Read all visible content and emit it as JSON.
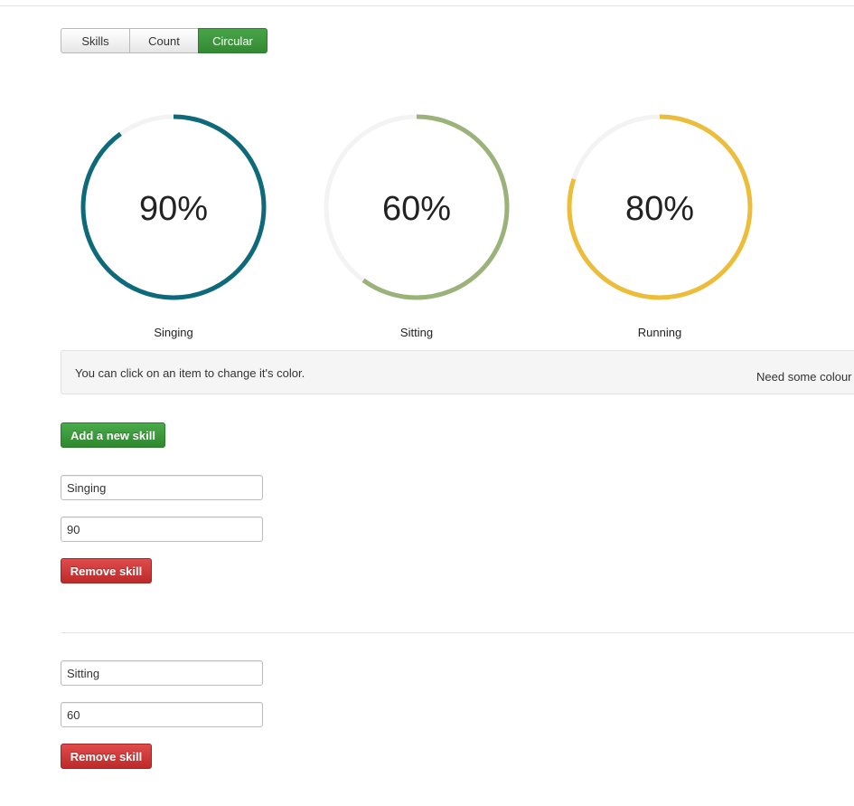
{
  "tabs": [
    {
      "label": "Skills"
    },
    {
      "label": "Count"
    },
    {
      "label": "Circular"
    }
  ],
  "active_tab": "Circular",
  "skills": [
    {
      "label": "Singing",
      "percent_text": "90%",
      "value": 90,
      "color": "#0e6a7a"
    },
    {
      "label": "Sitting",
      "percent_text": "60%",
      "value": 60,
      "color": "#9bb27a"
    },
    {
      "label": "Running",
      "percent_text": "80%",
      "value": 80,
      "color": "#ecbd3a"
    }
  ],
  "info": {
    "left": "You can click on an item to change it's color.",
    "right": "Need some colour i"
  },
  "add_button": "Add a new skill",
  "editors": [
    {
      "name_value": "Singing",
      "value_value": "90",
      "remove_label": "Remove skill"
    },
    {
      "name_value": "Sitting",
      "value_value": "60",
      "remove_label": "Remove skill"
    }
  ],
  "colors": {
    "green_button": "#3b993b",
    "red_button": "#d13a3a",
    "track": "#f3f3f3"
  }
}
